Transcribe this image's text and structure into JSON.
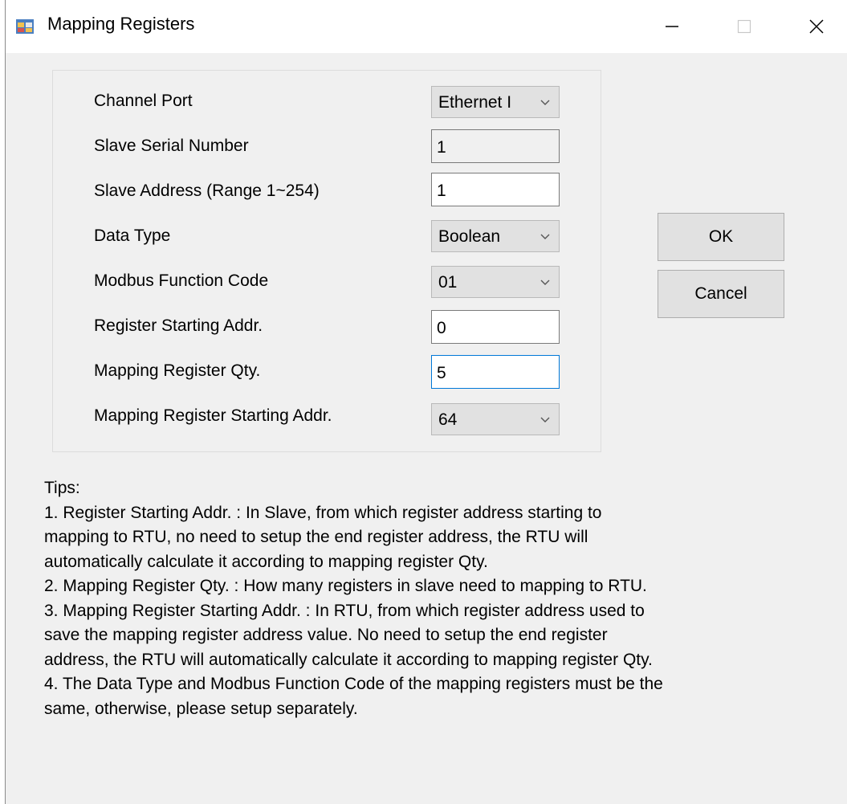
{
  "window": {
    "title": "Mapping Registers"
  },
  "form": {
    "fields": [
      {
        "label": "Channel Port",
        "value": "Ethernet I"
      },
      {
        "label": "Slave Serial Number",
        "value": "1"
      },
      {
        "label": "Slave Address (Range 1~254)",
        "value": "1"
      },
      {
        "label": "Data Type",
        "value": "Boolean"
      },
      {
        "label": "Modbus Function Code",
        "value": "01"
      },
      {
        "label": "Register Starting Addr.",
        "value": "0"
      },
      {
        "label": "Mapping Register Qty.",
        "value": "5"
      },
      {
        "label": "Mapping Register Starting Addr.",
        "value": "64"
      }
    ]
  },
  "buttons": {
    "ok": "OK",
    "cancel": "Cancel"
  },
  "tips": {
    "lines": [
      "Tips:",
      "1. Register Starting Addr. : In Slave, from which register address starting to",
      "mapping to RTU, no need to setup the end register address, the RTU will",
      "automatically calculate it according to mapping register Qty.",
      "2. Mapping Register Qty. : How many registers in slave need to mapping to RTU.",
      "3. Mapping Register Starting Addr. : In RTU, from which register address used to",
      "save the mapping register address value. No need to setup the end register",
      "address, the RTU will automatically calculate it according to mapping register Qty.",
      "4. The Data Type and Modbus Function Code of the mapping registers must be the",
      "same, otherwise, please setup separately."
    ]
  },
  "icons": {
    "app": "app-window-icon",
    "dropdown": "chevron-down-icon",
    "minimize": "minimize-icon",
    "maximize": "maximize-icon",
    "close": "close-icon"
  },
  "colors": {
    "focus_border": "#0078d7",
    "window_bg": "#f0f0f0",
    "button_bg": "#e1e1e1"
  }
}
